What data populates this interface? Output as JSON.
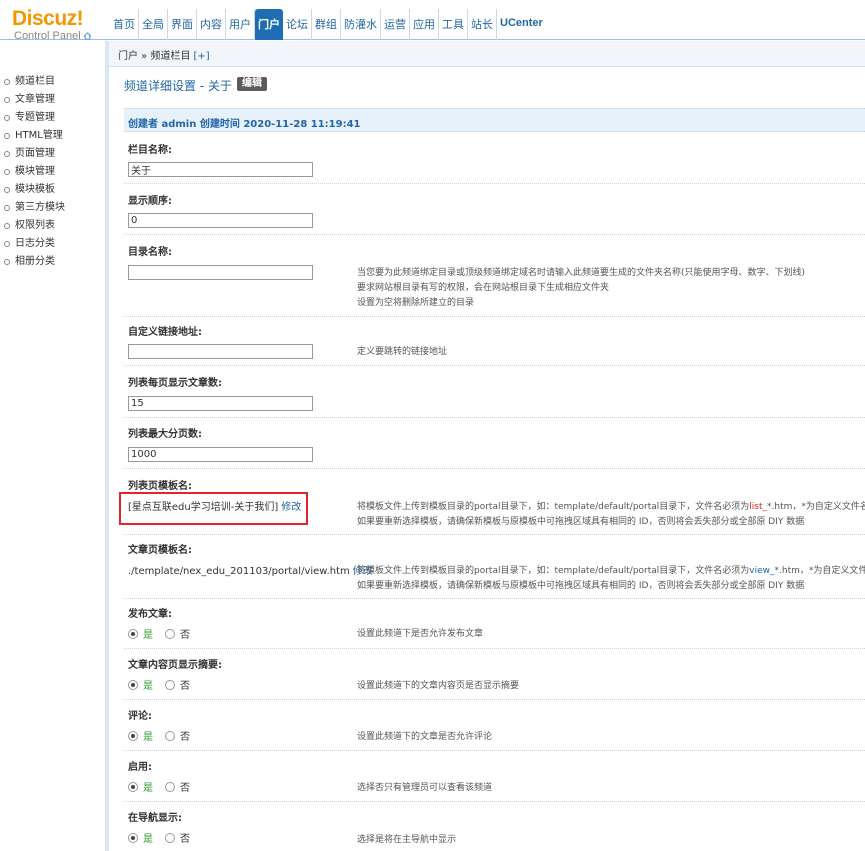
{
  "logo": {
    "main": "Discuz!",
    "sub": "Control Panel"
  },
  "nav": [
    {
      "label": "首页"
    },
    {
      "label": "全局"
    },
    {
      "label": "界面"
    },
    {
      "label": "内容"
    },
    {
      "label": "用户"
    },
    {
      "label": "门户",
      "active": true
    },
    {
      "label": "论坛"
    },
    {
      "label": "群组"
    },
    {
      "label": "防灌水"
    },
    {
      "label": "运营"
    },
    {
      "label": "应用"
    },
    {
      "label": "工具"
    },
    {
      "label": "站长"
    },
    {
      "label": "UCenter"
    }
  ],
  "breadcrumb": {
    "text": "门户 » 频道栏目",
    "plus": "[+]"
  },
  "sidebar": {
    "items": [
      "频道栏目",
      "文章管理",
      "专题管理",
      "HTML管理",
      "页面管理",
      "模块管理",
      "模块模板",
      "第三方模块",
      "权限列表",
      "日志分类",
      "相册分类"
    ]
  },
  "page": {
    "title": "频道详细设置 - 关于",
    "edit_label": "编辑",
    "creator": "创建者 admin 创建时间 2020-11-28 11:19:41"
  },
  "form": {
    "name": {
      "label": "栏目名称:",
      "value": "关于"
    },
    "order": {
      "label": "显示顺序:",
      "value": "0"
    },
    "dir": {
      "label": "目录名称:",
      "value": "",
      "hint1": "当您要为此频道绑定目录或顶级频道绑定域名时请输入此频道要生成的文件夹名称(只能使用字母、数字、下划线)",
      "hint2": "要求网站根目录有写的权限，会在网站根目录下生成相应文件夹",
      "hint3": "设置为空将删除所建立的目录"
    },
    "url": {
      "label": "自定义链接地址:",
      "value": "",
      "hint": "定义要跳转的链接地址"
    },
    "perpage": {
      "label": "列表每页显示文章数:",
      "value": "15"
    },
    "maxpages": {
      "label": "列表最大分页数:",
      "value": "1000"
    },
    "listtpl": {
      "label": "列表页模板名:",
      "value": "[星点互联edu学习培训-关于我们]",
      "modify": "修改",
      "hint1_a": "将模板文件上传到模板目录的portal目录下，如：template/default/portal目录下，文件名必须为",
      "hint1_b": "list_",
      "hint1_c": "*.htm，*为自定义文件名",
      "hint2": "如果要重新选择模板，请确保新模板与原模板中可拖拽区域具有相同的 ID，否则将会丢失部分或全部原 DIY 数据"
    },
    "viewtpl": {
      "label": "文章页模板名:",
      "value": "./template/nex_edu_201103/portal/view.htm",
      "modify": "修改",
      "hint1_a": "将模板文件上传到模板目录的portal目录下，如：template/default/portal目录下，文件名必须为",
      "hint1_b": "view_",
      "hint1_c": "*.htm，*为自定义文件名",
      "hint2": "如果要重新选择模板，请确保新模板与原模板中可拖拽区域具有相同的 ID，否则将会丢失部分或全部原 DIY 数据"
    },
    "yes_label": "是",
    "no_label": "否",
    "publish": {
      "label": "发布文章:",
      "hint": "设置此频道下是否允许发布文章"
    },
    "summary": {
      "label": "文章内容页显示摘要:",
      "hint": "设置此频道下的文章内容页是否显示摘要"
    },
    "comment": {
      "label": "评论:",
      "hint": "设置此频道下的文章是否允许评论"
    },
    "enable": {
      "label": "启用:",
      "hint": "选择否只有管理员可以查看该频道"
    },
    "navshow": {
      "label": "在导航显示:",
      "hint": "选择是将在主导航中显示"
    }
  }
}
